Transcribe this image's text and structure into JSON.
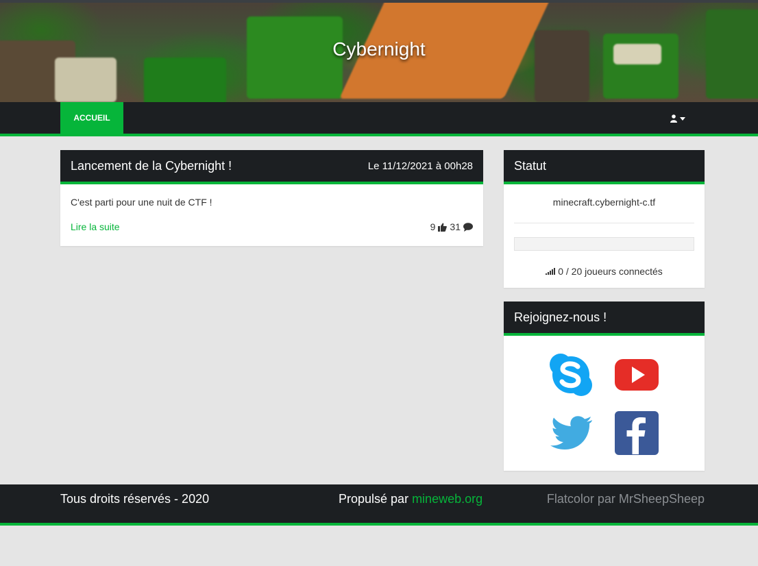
{
  "site": {
    "title": "Cybernight"
  },
  "nav": {
    "home_label": "ACCUEIL",
    "user_icon": "user-icon",
    "caret_icon": "caret-down-icon"
  },
  "news": {
    "title": "Lancement de la Cybernight !",
    "date": "Le 11/12/2021 à 00h28",
    "content": "C'est parti pour une nuit de CTF !",
    "read_more": "Lire la suite",
    "likes": "9",
    "comments": "31"
  },
  "status": {
    "title": "Statut",
    "server": "minecraft.cybernight-c.tf",
    "players_online": 0,
    "players_max": 20,
    "players_text": "0 / 20 joueurs connectés"
  },
  "join": {
    "title": "Rejoignez-nous !",
    "networks": [
      "skype-icon",
      "youtube-icon",
      "twitter-icon",
      "facebook-icon"
    ]
  },
  "footer": {
    "copyright": "Tous droits réservés - 2020",
    "powered_prefix": "Propulsé par ",
    "powered_link": "mineweb.org",
    "theme_credit": "Flatcolor par MrSheepSheep"
  },
  "colors": {
    "accent": "#06b53a",
    "dark": "#1c1f22",
    "background": "#e5e5e5"
  }
}
